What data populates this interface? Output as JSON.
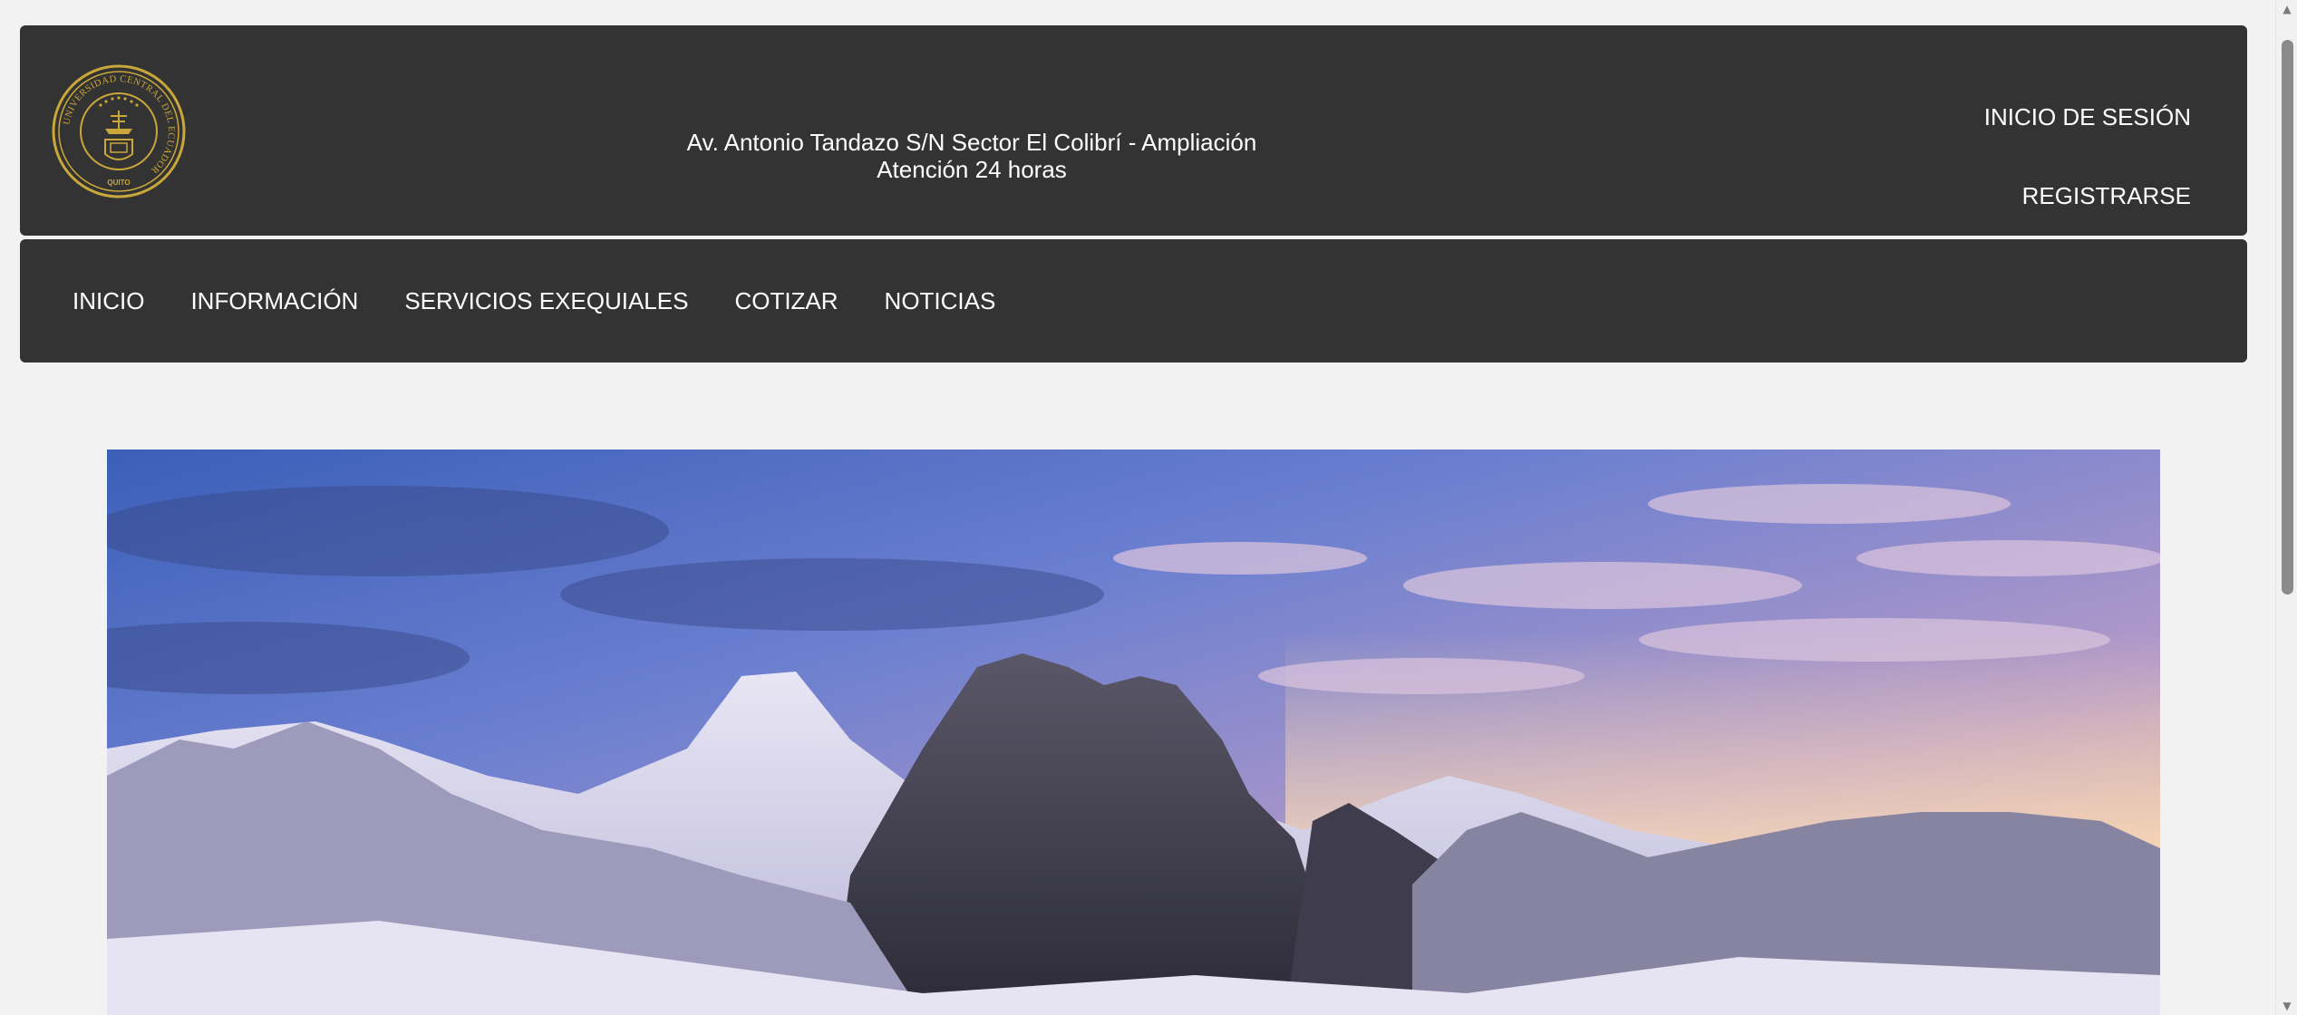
{
  "header": {
    "logo": {
      "icon": "university-seal-icon",
      "ring_text": "UNIVERSIDAD CENTRAL DEL ECUADOR",
      "bottom_text": "QUITO",
      "color": "#c9a73a"
    },
    "address_line1": "Av. Antonio Tandazo S/N Sector El Colibrí - Ampliación",
    "address_line2": "Atención 24 horas",
    "login_label": "INICIO DE SESIÓN",
    "register_label": "REGISTRARSE",
    "background": "#333333"
  },
  "nav": {
    "items": [
      {
        "label": "INICIO"
      },
      {
        "label": "INFORMACIÓN"
      },
      {
        "label": "SERVICIOS EXEQUIALES"
      },
      {
        "label": "COTIZAR"
      },
      {
        "label": "NOTICIAS"
      }
    ]
  },
  "hero": {
    "image": "mountain-landscape-image"
  },
  "scrollbar": {
    "up_icon": "scroll-up-arrow-icon",
    "down_icon": "scroll-down-arrow-icon"
  }
}
